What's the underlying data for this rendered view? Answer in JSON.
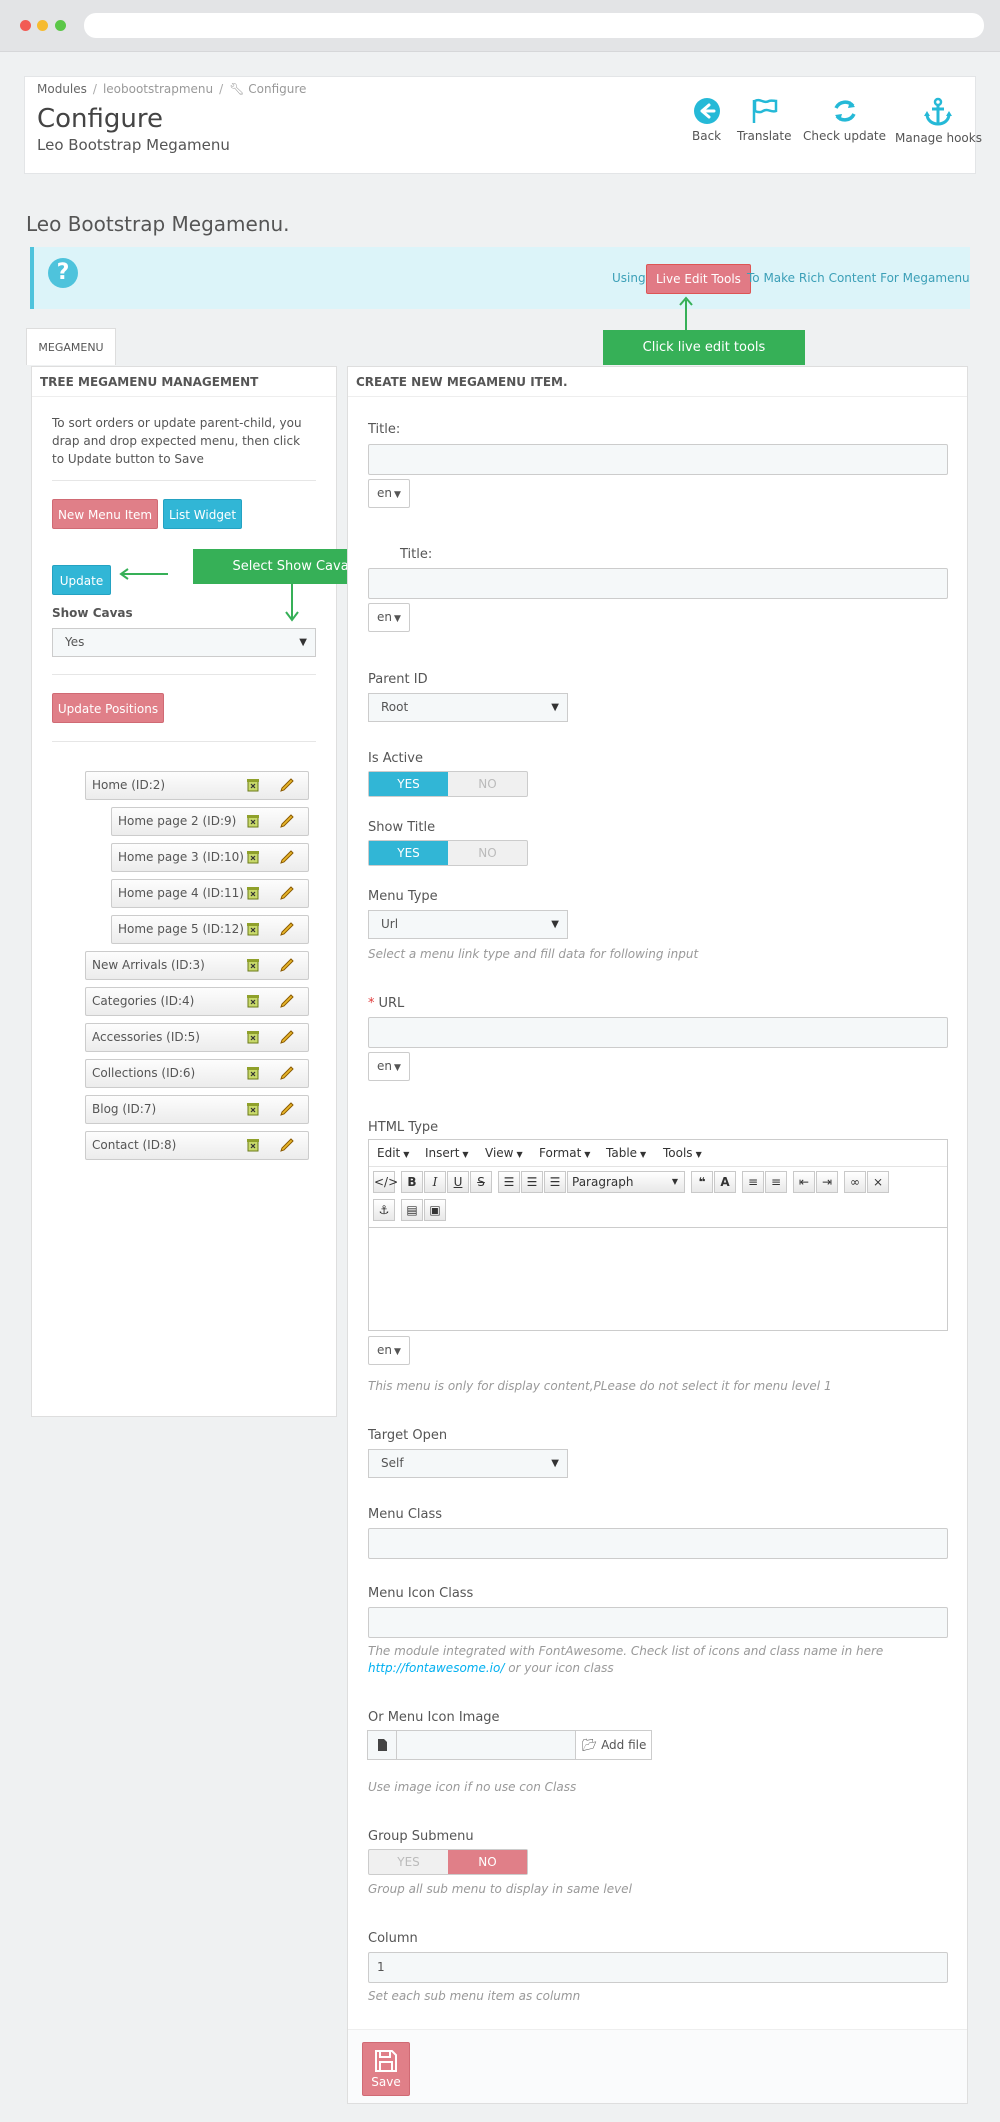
{
  "breadcrumb": {
    "item1": "Modules",
    "item2": "leobootstrapmenu",
    "item3": "Configure"
  },
  "header": {
    "title": "Configure",
    "subtitle": "Leo Bootstrap Megamenu"
  },
  "toolbar": {
    "back": "Back",
    "translate": "Translate",
    "check_update": "Check update",
    "manage_hooks": "Manage hooks"
  },
  "section_heading": "Leo Bootstrap Megamenu.",
  "alert": {
    "using": "Using",
    "live_button": "Live Edit Tools",
    "rest": "To Make Rich Content For Megamenu"
  },
  "callouts": {
    "live": "Click live edit tools",
    "cavas": "Select Show Cavas"
  },
  "tab": "MEGAMENU",
  "left_panel": {
    "heading": "TREE MEGAMENU MANAGEMENT",
    "help": "To sort orders or update parent-child, you drap and drop expected menu, then click to Update button to Save",
    "new_item": "New Menu Item",
    "list_widget": "List Widget",
    "update": "Update",
    "show_cavas_label": "Show Cavas",
    "show_cavas_value": "Yes",
    "update_positions": "Update Positions",
    "tree": [
      {
        "label": "Home (ID:2)",
        "level": 0
      },
      {
        "label": "Home page 2 (ID:9)",
        "level": 1
      },
      {
        "label": "Home page 3 (ID:10)",
        "level": 1
      },
      {
        "label": "Home page 4 (ID:11)",
        "level": 1
      },
      {
        "label": "Home page 5 (ID:12)",
        "level": 1
      },
      {
        "label": "New Arrivals (ID:3)",
        "level": 0
      },
      {
        "label": "Categories (ID:4)",
        "level": 0
      },
      {
        "label": "Accessories (ID:5)",
        "level": 0
      },
      {
        "label": "Collections (ID:6)",
        "level": 0
      },
      {
        "label": "Blog (ID:7)",
        "level": 0
      },
      {
        "label": "Contact (ID:8)",
        "level": 0
      }
    ]
  },
  "right_panel": {
    "heading": "CREATE NEW MEGAMENU ITEM.",
    "title_label": "Title:",
    "sub_title_label": "Title:",
    "lang": "en",
    "parent_id_label": "Parent ID",
    "parent_id_value": "Root",
    "is_active_label": "Is Active",
    "show_title_label": "Show Title",
    "yes": "YES",
    "no": "NO",
    "menu_type_label": "Menu Type",
    "menu_type_value": "Url",
    "menu_type_help": "Select a menu link type and fill data for following input",
    "url_label": "URL",
    "html_type_label": "HTML Type",
    "editor_menus": {
      "edit": "Edit",
      "insert": "Insert",
      "view": "View",
      "format": "Format",
      "table": "Table",
      "tools": "Tools"
    },
    "paragraph": "Paragraph",
    "html_help": "This menu is only for display content,PLease do not select it for menu level 1",
    "target_label": "Target Open",
    "target_value": "Self",
    "menu_class_label": "Menu Class",
    "menu_icon_class_label": "Menu Icon Class",
    "icon_help_1": "The module integrated with FontAwesome. Check list of icons and class name in here",
    "icon_help_link": "http://fontawesome.io/",
    "icon_help_2": " or your icon class",
    "icon_image_label": "Or Menu Icon Image",
    "add_file": "Add file",
    "icon_image_help": "Use image icon if no use con Class",
    "group_submenu_label": "Group Submenu",
    "group_help": "Group all sub menu to display in same level",
    "column_label": "Column",
    "column_value": "1",
    "column_help": "Set each sub menu item as column",
    "save": "Save"
  },
  "colors": {
    "accent_blue": "#31b6d6",
    "accent_red": "#e07f88",
    "callout_green": "#36b057"
  }
}
